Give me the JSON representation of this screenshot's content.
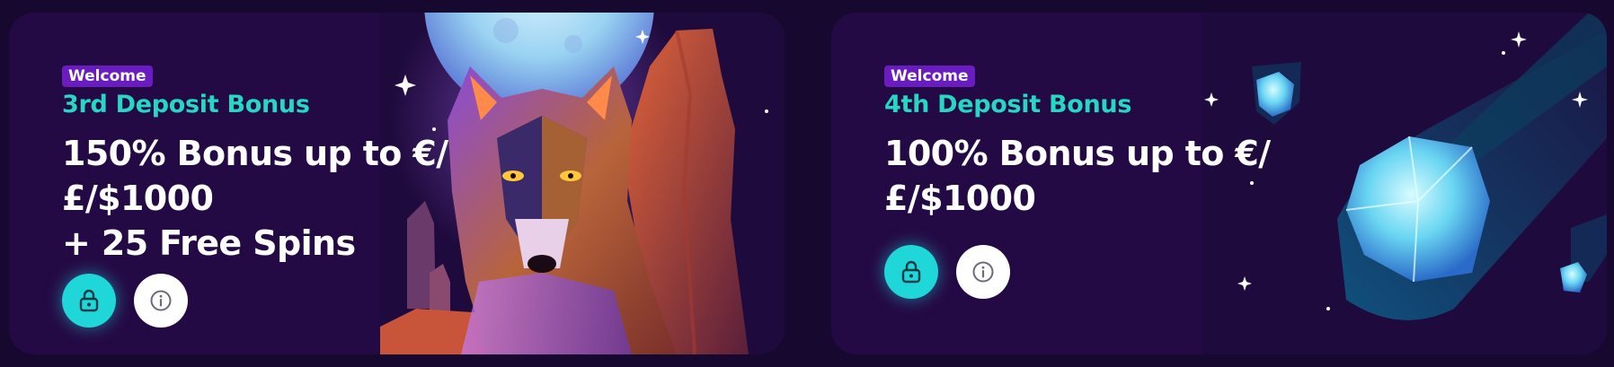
{
  "cards": [
    {
      "badge": "Welcome",
      "title": "3rd Deposit Bonus",
      "headline_lines": [
        "150% Bonus up to €/",
        "£/$1000",
        "+ 25 Free Spins"
      ],
      "lock_icon": "lock-icon",
      "info_icon": "info-icon",
      "illustration": "wolf-moon-canyon"
    },
    {
      "badge": "Welcome",
      "title": "4th Deposit Bonus",
      "headline_lines": [
        "100% Bonus up to €/",
        "£/$1000"
      ],
      "lock_icon": "lock-icon",
      "info_icon": "info-icon",
      "illustration": "ice-crystal-meteors"
    }
  ],
  "colors": {
    "background": "#170830",
    "card": "#240a45",
    "badge": "#6a1cc0",
    "accent_teal": "#27d6c3",
    "lock_button": "#1fd6d8",
    "text": "#ffffff"
  }
}
